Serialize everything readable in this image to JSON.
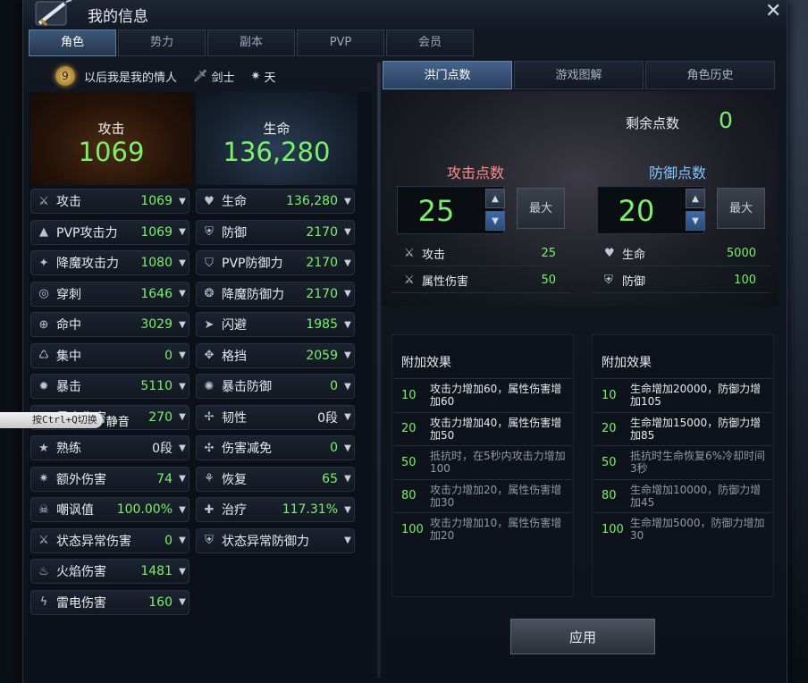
{
  "window": {
    "title": "我的信息"
  },
  "main_tabs": [
    {
      "label": "角色",
      "active": true
    },
    {
      "label": "势力",
      "active": false
    },
    {
      "label": "副本",
      "active": false
    },
    {
      "label": "PVP",
      "active": false
    },
    {
      "label": "会员",
      "active": false
    }
  ],
  "character": {
    "level": "9",
    "name": "以后我是我的情人",
    "class": "剑士",
    "element": "天"
  },
  "big_stats": {
    "attack": {
      "label": "攻击",
      "value": "1069"
    },
    "hp": {
      "label": "生命",
      "value": "136,280"
    }
  },
  "left_stats": [
    {
      "icon": "crossed-swords-icon",
      "label": "攻击",
      "value": "1069"
    },
    {
      "icon": "pvp-attack-icon",
      "label": "PVP攻击力",
      "value": "1069"
    },
    {
      "icon": "demon-attack-icon",
      "label": "降魔攻击力",
      "value": "1080"
    },
    {
      "icon": "pierce-icon",
      "label": "穿刺",
      "value": "1646"
    },
    {
      "icon": "target-icon",
      "label": "命中",
      "value": "3029"
    },
    {
      "icon": "focus-icon",
      "label": "集中",
      "value": "0"
    },
    {
      "icon": "critical-icon",
      "label": "暴击",
      "value": "5110"
    },
    {
      "icon": "crit-damage-icon",
      "label": "暴击伤害",
      "value": "270"
    },
    {
      "icon": "mastery-icon",
      "label": "熟练",
      "value": "0段"
    },
    {
      "icon": "extra-damage-icon",
      "label": "额外伤害",
      "value": "74"
    },
    {
      "icon": "taunt-icon",
      "label": "嘲讽值",
      "value": "100.00%"
    },
    {
      "icon": "status-damage-icon",
      "label": "状态异常伤害",
      "value": "0"
    },
    {
      "icon": "fire-icon",
      "label": "火焰伤害",
      "value": "1481"
    },
    {
      "icon": "lightning-icon",
      "label": "雷电伤害",
      "value": "160"
    }
  ],
  "right_stats": [
    {
      "icon": "heart-icon",
      "label": "生命",
      "value": "136,280"
    },
    {
      "icon": "shield-icon",
      "label": "防御",
      "value": "2170"
    },
    {
      "icon": "pvp-defense-icon",
      "label": "PVP防御力",
      "value": "2170"
    },
    {
      "icon": "demon-defense-icon",
      "label": "降魔防御力",
      "value": "2170"
    },
    {
      "icon": "evade-icon",
      "label": "闪避",
      "value": "1985"
    },
    {
      "icon": "block-icon",
      "label": "格挡",
      "value": "2059"
    },
    {
      "icon": "crit-defense-icon",
      "label": "暴击防御",
      "value": "0"
    },
    {
      "icon": "toughness-icon",
      "label": "韧性",
      "value": "0段"
    },
    {
      "icon": "damage-reduce-icon",
      "label": "伤害减免",
      "value": "0"
    },
    {
      "icon": "recover-icon",
      "label": "恢复",
      "value": "65"
    },
    {
      "icon": "heal-icon",
      "label": "治疗",
      "value": "117.31%"
    },
    {
      "icon": "status-defense-icon",
      "label": "状态异常防御力",
      "value": ""
    }
  ],
  "right_tabs": [
    {
      "label": "洪门点数",
      "active": true
    },
    {
      "label": "游戏图解",
      "active": false
    },
    {
      "label": "角色历史",
      "active": false
    }
  ],
  "points": {
    "remaining_label": "剩余点数",
    "remaining_value": "0",
    "max_label": "最大",
    "attack": {
      "title": "攻击点数",
      "value": "25",
      "lines": [
        {
          "label": "攻击",
          "value": "25"
        },
        {
          "label": "属性伤害",
          "value": "50"
        }
      ],
      "effects_title": "附加效果",
      "effects": [
        {
          "level": "10",
          "text": "攻击力增加60，属性伤害增加60",
          "active": true
        },
        {
          "level": "20",
          "text": "攻击力增加40，属性伤害增加50",
          "active": true
        },
        {
          "level": "50",
          "text": "抵抗时，在5秒内攻击力增加100",
          "active": false
        },
        {
          "level": "80",
          "text": "攻击力增加20，属性伤害增加30",
          "active": false
        },
        {
          "level": "100",
          "text": "攻击力增加10，属性伤害增加20",
          "active": false
        }
      ]
    },
    "defense": {
      "title": "防御点数",
      "value": "20",
      "lines": [
        {
          "label": "生命",
          "value": "5000"
        },
        {
          "label": "防御",
          "value": "100"
        }
      ],
      "effects_title": "附加效果",
      "effects": [
        {
          "level": "10",
          "text": "生命增加20000，防御力增加105",
          "active": true
        },
        {
          "level": "20",
          "text": "生命增加15000，防御力增加85",
          "active": true
        },
        {
          "level": "50",
          "text": "抵抗时生命恢复6%冷却时间3秒",
          "active": false
        },
        {
          "level": "80",
          "text": "生命增加10000，防御力增加45",
          "active": false
        },
        {
          "level": "100",
          "text": "生命增加5000，防御力增加30",
          "active": false
        }
      ]
    },
    "apply_label": "应用"
  },
  "voice_overlay": {
    "hint": "按Ctrl+Q切换",
    "mute": "静音"
  },
  "colors": {
    "accent_green": "#7bf06c",
    "attack_title": "#ff8a8a",
    "defense_title": "#7ec8ff",
    "tab_active": "#3d5878"
  }
}
